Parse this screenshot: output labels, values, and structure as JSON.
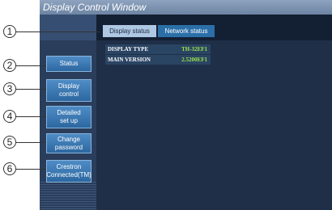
{
  "window": {
    "title": "Display Control Window"
  },
  "tabs": [
    {
      "label": "Display status",
      "active": true
    },
    {
      "label": "Network status",
      "active": false
    }
  ],
  "nav": {
    "status": [
      "Status"
    ],
    "display_control": [
      "Display",
      "control"
    ],
    "detailed_setup": [
      "Detailed",
      "set up"
    ],
    "change_password": [
      "Change",
      "password"
    ],
    "crestron": [
      "Crestron",
      "Connected(TM)"
    ]
  },
  "info": [
    {
      "label": "DISPLAY TYPE",
      "value": "TH-32EF1"
    },
    {
      "label": "MAIN VERSION",
      "value": "2.5200EF1"
    }
  ],
  "callouts": [
    "1",
    "2",
    "3",
    "4",
    "5",
    "6"
  ],
  "colors": {
    "value_text": "#9be24a",
    "button": "#3d7bb6",
    "window_bg": "#1c2c45"
  }
}
